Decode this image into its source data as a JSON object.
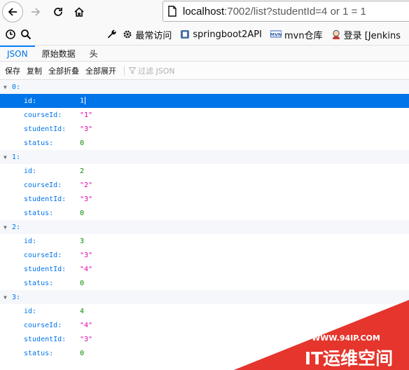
{
  "browser": {
    "url_host": "localhost",
    "url_rest": ":7002/list?studentId=4 or 1 = 1"
  },
  "bookmarks": [
    {
      "label": "最常访问",
      "icon": "gear-icon"
    },
    {
      "label": "springboot2API",
      "icon": "bookmark-icon"
    },
    {
      "label": "mvn仓库",
      "icon": "mvn-icon"
    },
    {
      "label": "登录 [Jenkins",
      "icon": "jenkins-icon"
    }
  ],
  "tabs": [
    {
      "label": "JSON",
      "active": true
    },
    {
      "label": "原始数据",
      "active": false
    },
    {
      "label": "头",
      "active": false
    }
  ],
  "toolbar": {
    "save": "保存",
    "copy": "复制",
    "collapse_all": "全部折叠",
    "expand_all": "全部展开",
    "filter_placeholder": "过滤 JSON"
  },
  "json_groups": [
    {
      "index": "0:",
      "fields": [
        {
          "key": "id:",
          "value": "1",
          "type": "num"
        },
        {
          "key": "courseId:",
          "value": "\"1\"",
          "type": "str"
        },
        {
          "key": "studentId:",
          "value": "\"3\"",
          "type": "str"
        },
        {
          "key": "status:",
          "value": "0",
          "type": "num"
        }
      ]
    },
    {
      "index": "1:",
      "fields": [
        {
          "key": "id:",
          "value": "2",
          "type": "num"
        },
        {
          "key": "courseId:",
          "value": "\"2\"",
          "type": "str"
        },
        {
          "key": "studentId:",
          "value": "\"3\"",
          "type": "str"
        },
        {
          "key": "status:",
          "value": "0",
          "type": "num"
        }
      ]
    },
    {
      "index": "2:",
      "fields": [
        {
          "key": "id:",
          "value": "3",
          "type": "num"
        },
        {
          "key": "courseId:",
          "value": "\"3\"",
          "type": "str"
        },
        {
          "key": "studentId:",
          "value": "\"4\"",
          "type": "str"
        },
        {
          "key": "status:",
          "value": "0",
          "type": "num"
        }
      ]
    },
    {
      "index": "3:",
      "fields": [
        {
          "key": "id:",
          "value": "4",
          "type": "num"
        },
        {
          "key": "courseId:",
          "value": "\"4\"",
          "type": "str"
        },
        {
          "key": "studentId:",
          "value": "\"3\"",
          "type": "str"
        },
        {
          "key": "status:",
          "value": "0",
          "type": "num"
        }
      ]
    }
  ],
  "watermark": {
    "site": "WWW.94IP.COM",
    "brand": "IT运维空间"
  }
}
